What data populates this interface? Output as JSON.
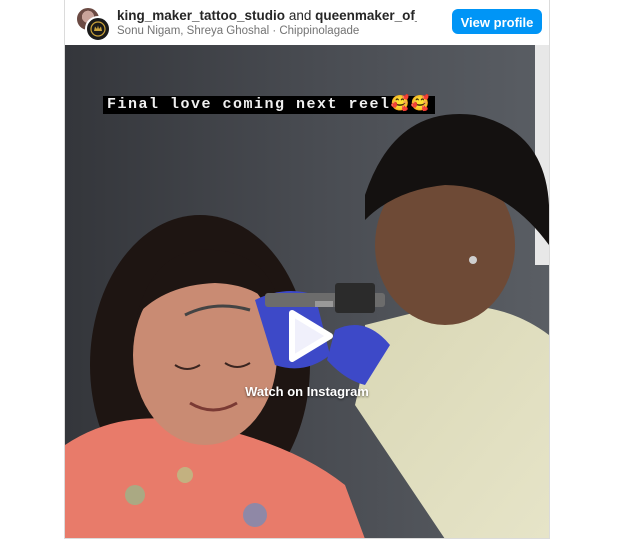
{
  "post": {
    "account_primary": "king_maker_tattoo_studio",
    "joiner": "and",
    "account_secondary": "queenmaker_of_t...",
    "subline": "Sonu Nigam, Shreya Ghoshal · Chippinolagade",
    "view_profile_label": "View profile"
  },
  "media": {
    "overlay_caption": "Final love coming next reel🥰🥰",
    "watch_label": "Watch on Instagram",
    "play_icon": "play-icon"
  },
  "colors": {
    "button_blue": "#0095f6",
    "text_dark": "#262626",
    "text_muted": "#737373",
    "border": "#dbdbdb"
  }
}
